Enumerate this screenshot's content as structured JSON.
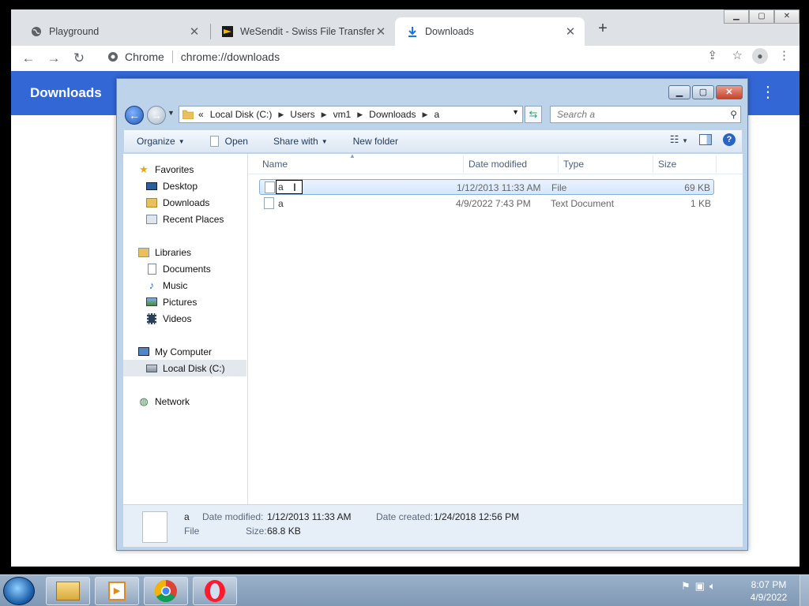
{
  "chrome": {
    "tabs": [
      {
        "title": "Playground",
        "icon": "globe-icon"
      },
      {
        "title": "WeSendit - Swiss File Transfer Se",
        "icon": "wesendit-icon"
      },
      {
        "title": "Downloads",
        "icon": "download-icon"
      }
    ],
    "new_tab": "+",
    "omnibox": {
      "site": "Chrome",
      "url": "chrome://downloads"
    },
    "page_title": "Downloads",
    "accent": "#3367d6"
  },
  "explorer": {
    "breadcrumb": [
      "Local Disk (C:)",
      "Users",
      "vm1",
      "Downloads",
      "a"
    ],
    "breadcrumb_prefix": "«",
    "search_placeholder": "Search a",
    "commands": {
      "organize": "Organize",
      "open": "Open",
      "share_with": "Share with",
      "new_folder": "New folder"
    },
    "nav": {
      "favorites": "Favorites",
      "desktop": "Desktop",
      "downloads": "Downloads",
      "recent": "Recent Places",
      "libraries": "Libraries",
      "documents": "Documents",
      "music": "Music",
      "pictures": "Pictures",
      "videos": "Videos",
      "computer": "My Computer",
      "local_disk": "Local Disk (C:)",
      "network": "Network"
    },
    "columns": {
      "name": "Name",
      "date": "Date modified",
      "type": "Type",
      "size": "Size"
    },
    "files": [
      {
        "name": "a",
        "date": "1/12/2013 11:33 AM",
        "type": "File",
        "size": "69 KB"
      },
      {
        "name": "a",
        "date": "4/9/2022 7:43 PM",
        "type": "Text Document",
        "size": "1 KB"
      }
    ],
    "details": {
      "name": "a",
      "kind": "File",
      "modified_label": "Date modified:",
      "modified": "1/12/2013 11:33 AM",
      "created_label": "Date created:",
      "created": "1/24/2018 12:56 PM",
      "size_label": "Size:",
      "size": "68.8 KB"
    }
  },
  "taskbar": {
    "time": "8:07 PM",
    "date": "4/9/2022"
  }
}
